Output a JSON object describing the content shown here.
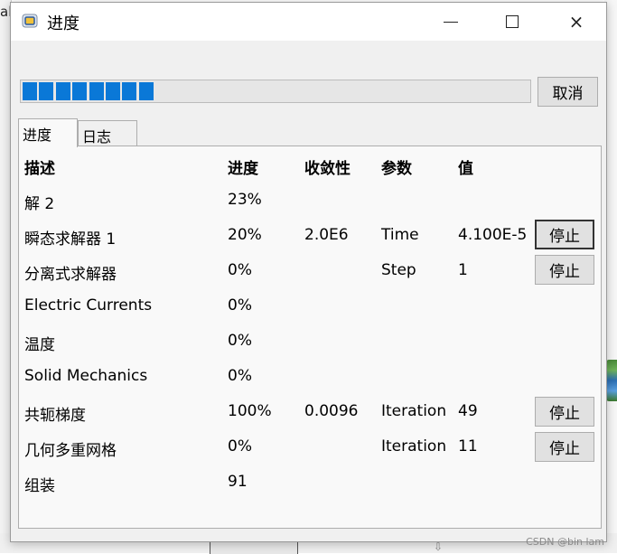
{
  "background": {
    "left_text": "al",
    "watermark": "CSDN @bin lam"
  },
  "window": {
    "title": "进度",
    "controls": {
      "minimize": "minimize",
      "maximize": "maximize",
      "close": "×"
    }
  },
  "progress": {
    "fraction": 0.25,
    "segments_filled": 8,
    "cancel_label": "取消"
  },
  "tabs": [
    {
      "label": "进度",
      "active": true
    },
    {
      "label": "日志",
      "active": false
    }
  ],
  "table": {
    "headers": {
      "desc": "描述",
      "progress": "进度",
      "convergence": "收敛性",
      "param": "参数",
      "value": "值"
    },
    "rows": [
      {
        "desc": "解 2",
        "progress": "23%",
        "convergence": "",
        "param": "",
        "value": "",
        "button": ""
      },
      {
        "desc": "瞬态求解器 1",
        "progress": "20%",
        "convergence": "2.0E6",
        "param": "Time",
        "value": "4.100E-5",
        "button": "停止"
      },
      {
        "desc": "分离式求解器",
        "progress": "0%",
        "convergence": "",
        "param": "Step",
        "value": "1",
        "button": "停止"
      },
      {
        "desc": "Electric Currents",
        "progress": "0%",
        "convergence": "",
        "param": "",
        "value": "",
        "button": ""
      },
      {
        "desc": "温度",
        "progress": "0%",
        "convergence": "",
        "param": "",
        "value": "",
        "button": ""
      },
      {
        "desc": "Solid Mechanics",
        "progress": "0%",
        "convergence": "",
        "param": "",
        "value": "",
        "button": ""
      },
      {
        "desc": "共轭梯度",
        "progress": "100%",
        "convergence": "0.0096",
        "param": "Iteration",
        "value": "49",
        "button": "停止"
      },
      {
        "desc": "几何多重网格",
        "progress": "0%",
        "convergence": "",
        "param": "Iteration",
        "value": "11",
        "button": "停止"
      },
      {
        "desc": "组装",
        "progress": "91",
        "convergence": "",
        "param": "",
        "value": "",
        "button": ""
      }
    ]
  }
}
